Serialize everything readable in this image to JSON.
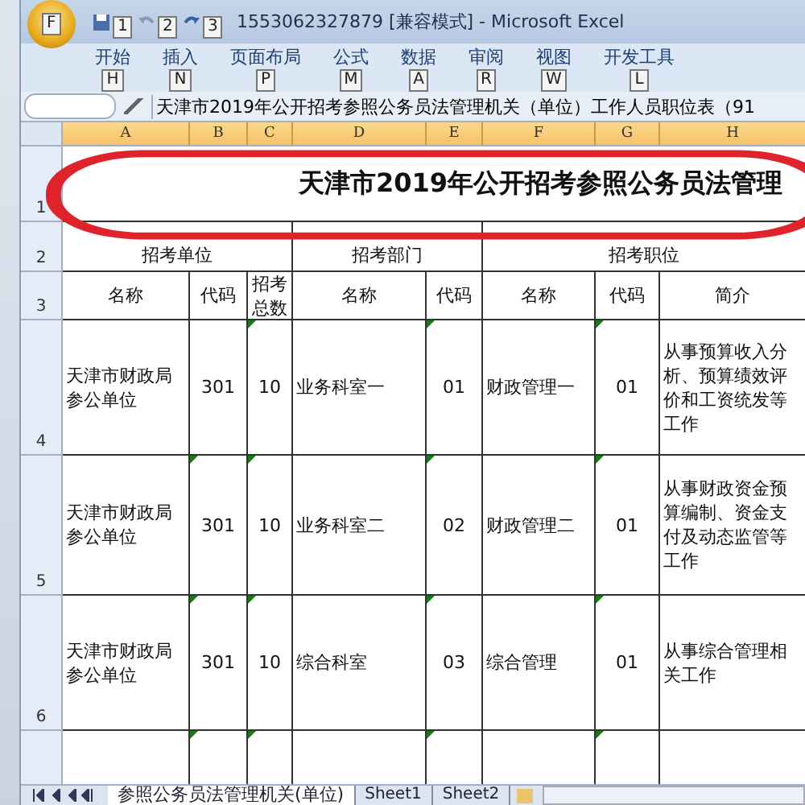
{
  "window": {
    "title": "1553062327879  [兼容模式] - Microsoft Excel"
  },
  "office_button": {
    "keytip": "F"
  },
  "quick_access": [
    {
      "keytip": "1"
    },
    {
      "keytip": "2"
    },
    {
      "keytip": "3"
    }
  ],
  "ribbon_tabs": [
    {
      "label": "开始",
      "keytip": "H"
    },
    {
      "label": "插入",
      "keytip": "N"
    },
    {
      "label": "页面布局",
      "keytip": "P"
    },
    {
      "label": "公式",
      "keytip": "M"
    },
    {
      "label": "数据",
      "keytip": "A"
    },
    {
      "label": "审阅",
      "keytip": "R"
    },
    {
      "label": "视图",
      "keytip": "W"
    },
    {
      "label": "开发工具",
      "keytip": "L"
    }
  ],
  "formula_bar": {
    "value": "天津市2019年公开招考参照公务员法管理机关（单位）工作人员职位表（91"
  },
  "columns": [
    "A",
    "B",
    "C",
    "D",
    "E",
    "F",
    "G",
    "H"
  ],
  "rows": [
    {
      "number": "1",
      "cells": [
        {
          "text": "天津市2019年公开招考参照公务员法管理",
          "kind": "title"
        }
      ]
    },
    {
      "number": "2",
      "cells": [
        {
          "text": "招考单位",
          "kind": "center"
        },
        {
          "text": "招考部门",
          "kind": "center"
        },
        {
          "text": "招考职位",
          "kind": "center"
        }
      ]
    },
    {
      "number": "3",
      "cells": [
        {
          "text": "名称",
          "kind": "center"
        },
        {
          "text": "代码",
          "kind": "center"
        },
        {
          "text": "招考总数",
          "kind": "center"
        },
        {
          "text": "名称",
          "kind": "center"
        },
        {
          "text": "代码",
          "kind": "center"
        },
        {
          "text": "名称",
          "kind": "center"
        },
        {
          "text": "代码",
          "kind": "center"
        },
        {
          "text": "简介",
          "kind": "center"
        }
      ]
    },
    {
      "number": "4",
      "cells": [
        {
          "text": "天津市财政局参公单位",
          "kind": "left"
        },
        {
          "text": "301",
          "kind": "center",
          "flag": false
        },
        {
          "text": "10",
          "kind": "center",
          "flag": true
        },
        {
          "text": "业务科室一",
          "kind": "left"
        },
        {
          "text": "01",
          "kind": "center",
          "flag": true
        },
        {
          "text": "财政管理一",
          "kind": "left"
        },
        {
          "text": "01",
          "kind": "center",
          "flag": true
        },
        {
          "text": "从事预算收入分析、预算绩效评价和工资统发等工作",
          "kind": "left"
        }
      ]
    },
    {
      "number": "5",
      "cells": [
        {
          "text": "天津市财政局参公单位",
          "kind": "left"
        },
        {
          "text": "301",
          "kind": "center",
          "flag": true
        },
        {
          "text": "10",
          "kind": "center",
          "flag": true
        },
        {
          "text": "业务科室二",
          "kind": "left"
        },
        {
          "text": "02",
          "kind": "center",
          "flag": true
        },
        {
          "text": "财政管理二",
          "kind": "left"
        },
        {
          "text": "01",
          "kind": "center",
          "flag": true
        },
        {
          "text": "从事财政资金预算编制、资金支付及动态监管等工作",
          "kind": "left"
        }
      ]
    },
    {
      "number": "6",
      "cells": [
        {
          "text": "天津市财政局参公单位",
          "kind": "left"
        },
        {
          "text": "301",
          "kind": "center",
          "flag": true
        },
        {
          "text": "10",
          "kind": "center",
          "flag": true
        },
        {
          "text": "综合科室",
          "kind": "left"
        },
        {
          "text": "03",
          "kind": "center",
          "flag": true
        },
        {
          "text": "综合管理",
          "kind": "left"
        },
        {
          "text": "01",
          "kind": "center",
          "flag": true
        },
        {
          "text": "从事综合管理相关工作",
          "kind": "left"
        }
      ]
    },
    {
      "number": "",
      "cells": [
        {
          "kind": "left"
        },
        {
          "kind": "center",
          "flag": true
        },
        {
          "kind": "center",
          "flag": true
        },
        {
          "kind": "left"
        },
        {
          "kind": "center",
          "flag": true
        },
        {
          "kind": "left"
        },
        {
          "kind": "center",
          "flag": true
        },
        {
          "kind": "left"
        }
      ]
    }
  ],
  "sheet_tabs": [
    {
      "label": "参照公务员法管理机关(单位)",
      "selected": true
    },
    {
      "label": "Sheet1",
      "selected": false
    },
    {
      "label": "Sheet2",
      "selected": false
    }
  ]
}
